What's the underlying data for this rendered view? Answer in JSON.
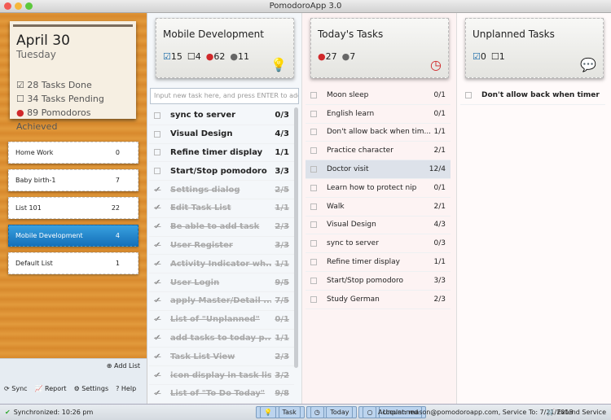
{
  "app": {
    "title": "PomodoroApp 3.0"
  },
  "summary": {
    "date": "April 30",
    "weekday": "Tuesday",
    "done": "28 Tasks Done",
    "pending": "34 Tasks Pending",
    "pomodoros": "89 Pomodoros Achieved"
  },
  "lists": [
    {
      "name": "Home Work",
      "count": "0"
    },
    {
      "name": "Baby birth-1",
      "count": "7"
    },
    {
      "name": "List 101",
      "count": "22"
    },
    {
      "name": "Mobile Development",
      "count": "4",
      "selected": true
    },
    {
      "name": "Default List",
      "count": "1"
    }
  ],
  "sidebar": {
    "add_list": "Add List",
    "sync": "Sync",
    "report": "Report",
    "settings": "Settings",
    "help": "Help"
  },
  "col1": {
    "title": "Mobile Development",
    "done": "15",
    "pending": "4",
    "pomodoros": "62",
    "interrupts": "11",
    "input_placeholder": "Input new task here, and press ENTER to add",
    "tasks": [
      {
        "name": "sync to server",
        "count": "0/3",
        "done": false
      },
      {
        "name": "Visual Design",
        "count": "4/3",
        "done": false
      },
      {
        "name": "Refine timer display",
        "count": "1/1",
        "done": false
      },
      {
        "name": "Start/Stop pomodoro",
        "count": "3/3",
        "done": false
      },
      {
        "name": "Settings dialog",
        "count": "2/5",
        "done": true
      },
      {
        "name": "Edit Task List",
        "count": "1/1",
        "done": true
      },
      {
        "name": "Be able to add task",
        "count": "2/3",
        "done": true
      },
      {
        "name": "User Register",
        "count": "3/3",
        "done": true
      },
      {
        "name": "Activity Indicator wh...",
        "count": "1/1",
        "done": true
      },
      {
        "name": "User Login",
        "count": "9/5",
        "done": true
      },
      {
        "name": "apply Master/Detail ...",
        "count": "7/5",
        "done": true
      },
      {
        "name": "List of \"Unplanned\"",
        "count": "0/1",
        "done": true
      },
      {
        "name": "add tasks to today p...",
        "count": "1/1",
        "done": true
      },
      {
        "name": "Task List View",
        "count": "2/3",
        "done": true
      },
      {
        "name": "icon display in task list",
        "count": "3/2",
        "done": true
      },
      {
        "name": "List of \"To Do Today\"",
        "count": "9/8",
        "done": true
      }
    ]
  },
  "col2": {
    "title": "Today's Tasks",
    "pomodoros": "27",
    "interrupts": "7",
    "tasks": [
      {
        "name": "Moon sleep",
        "count": "0/1"
      },
      {
        "name": "English learn",
        "count": "0/1"
      },
      {
        "name": "Don't allow back when tim...",
        "count": "1/1"
      },
      {
        "name": "Practice character",
        "count": "2/1"
      },
      {
        "name": "Doctor visit",
        "count": "12/4",
        "highlighted": true
      },
      {
        "name": "Learn how to protect nip",
        "count": "0/1"
      },
      {
        "name": "Walk",
        "count": "2/1"
      },
      {
        "name": "Visual Design",
        "count": "4/3"
      },
      {
        "name": "sync to server",
        "count": "0/3"
      },
      {
        "name": "Refine timer display",
        "count": "1/1"
      },
      {
        "name": "Start/Stop pomodoro",
        "count": "3/3"
      },
      {
        "name": "Study German",
        "count": "2/3"
      }
    ]
  },
  "col3": {
    "title": "Unplanned Tasks",
    "done": "0",
    "pending": "1",
    "tasks": [
      {
        "name": "Don't allow back when timer p..."
      }
    ]
  },
  "status": {
    "sync": "Synchronized: 10:26 pm",
    "task": "Task",
    "today": "Today",
    "unplanned": "Unplanned",
    "account": "Account: mason@pomodoroapp.com, Service To: 7/21/2013",
    "extend": "Extend Service"
  },
  "colors": {
    "wood": "#d98d2e",
    "selected": "#1a7cc8",
    "tomato": "#d0282a"
  }
}
